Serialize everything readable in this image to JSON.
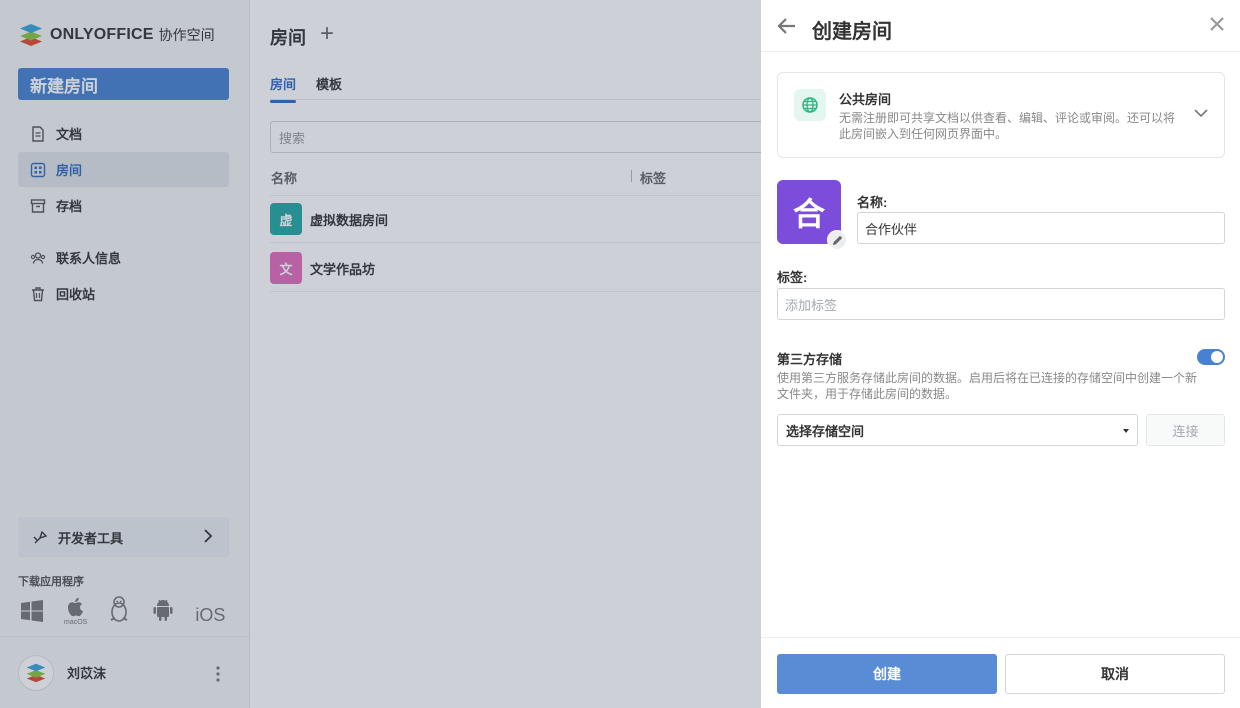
{
  "sidebar": {
    "logo_text": "ONLYOFFICE",
    "logo_sub": "协作空间",
    "new_room_label": "新建房间",
    "items": [
      {
        "label": "文档",
        "icon": "document-icon"
      },
      {
        "label": "房间",
        "icon": "rooms-icon",
        "active": true
      },
      {
        "label": "存档",
        "icon": "archive-icon"
      },
      {
        "label": "联系人信息",
        "icon": "contacts-icon"
      },
      {
        "label": "回收站",
        "icon": "trash-icon"
      }
    ],
    "dev_tools_label": "开发者工具",
    "download_title": "下载应用程序",
    "apps": [
      "windows-icon",
      "macos-icon",
      "linux-icon",
      "android-icon",
      "ios-icon"
    ],
    "apps_macos_caption": "macOS",
    "apps_ios_label": "iOS",
    "user_name": "刘苡沫"
  },
  "main": {
    "title": "房间",
    "tabs": [
      "房间",
      "模板"
    ],
    "search_placeholder": "搜索",
    "columns": [
      "名称",
      "标签"
    ],
    "rooms": [
      {
        "icon_char": "虚",
        "name": "虚拟数据房间",
        "color": "#22a7a2"
      },
      {
        "icon_char": "文",
        "name": "文学作品坊",
        "color": "#e06bbd"
      }
    ]
  },
  "panel": {
    "title": "创建房间",
    "room_type": {
      "title": "公共房间",
      "description": "无需注册即可共享文档以供查看、编辑、评论或审阅。还可以将此房间嵌入到任何网页界面中。"
    },
    "logo_char": "合",
    "name_label": "名称:",
    "name_value": "合作伙伴",
    "tags_label": "标签:",
    "tags_placeholder": "添加标签",
    "storage_title": "第三方存储",
    "storage_enabled": true,
    "storage_desc": "使用第三方服务存储此房间的数据。启用后将在已连接的存储空间中创建一个新文件夹，用于存储此房间的数据。",
    "storage_select": "选择存储空间",
    "connect_label": "连接",
    "create_label": "创建",
    "cancel_label": "取消"
  },
  "colors": {
    "accent": "#4781d1",
    "room_logo": "#7c4ddb",
    "public_room_icon": "#2db482"
  }
}
